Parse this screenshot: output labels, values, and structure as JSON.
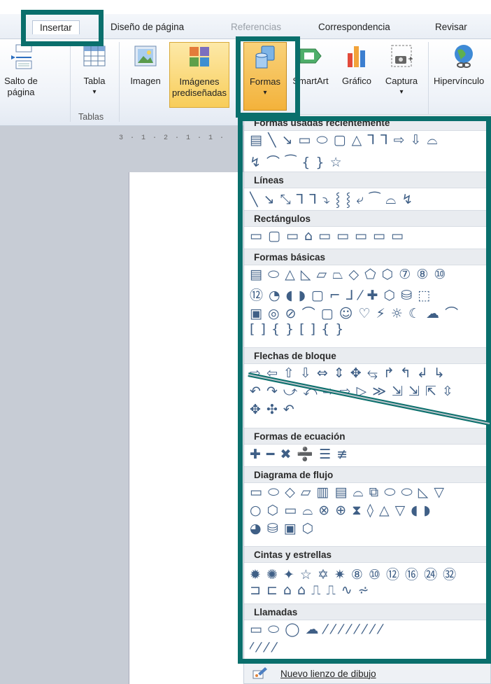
{
  "tabs": [
    {
      "label": "Insertar",
      "active": true
    },
    {
      "label": "Diseño de página",
      "active": false
    },
    {
      "label": "Referencias",
      "active": false,
      "dim": true
    },
    {
      "label": "Correspondencia",
      "active": false
    },
    {
      "label": "Revisar",
      "active": false
    }
  ],
  "ribbon": {
    "salto": {
      "line1": "Salto de",
      "line2": "página"
    },
    "tabla": {
      "label": "Tabla",
      "arrow": "▾"
    },
    "tablas_group": "Tablas",
    "imagen": "Imagen",
    "imagenes": {
      "line1": "Imágenes",
      "line2": "prediseñadas"
    },
    "formas": {
      "label": "Formas",
      "arrow": "▾"
    },
    "smartart": "SmartArt",
    "grafico": "Gráfico",
    "captura": {
      "label": "Captura",
      "arrow": "▾"
    },
    "hipervinculo": "Hipervínculo"
  },
  "ruler": "3 · 1 · 2 · 1 · 1 ·",
  "gallery": {
    "recent_header": "Formas usadas recientemente",
    "recent_rows": [
      "▤ ╲ ↘ ▭ ⬭ ▢ △ ⅂ ⅂ ⇨ ⇩ ⌓",
      "↯ ⌒ ⁀ { } ☆"
    ],
    "sections": [
      {
        "header": "Líneas",
        "rows": [
          "╲ ↘ ⤡ ⅂ ⅂ ⤵ ⸾ ⸾ ⤶ ⁀ ⌓ ↯"
        ]
      },
      {
        "header": "Rectángulos",
        "rows": [
          "▭ ▢ ▭ ⌂ ▭ ▭ ▭ ▭ ▭"
        ]
      },
      {
        "header": "Formas básicas",
        "rows": [
          "▤ ⬭ △ ◺ ▱ ⏢ ◇ ⬠ ⬡ ⑦ ⑧ ⑩",
          "⑫ ◔ ◖ ◗ ▢ ⌐ ⅃ ⁄ ✚ ⬡ ⛁ ⬚",
          "▣ ◎ ⊘ ⌒ ▢ ☺ ♡ ⚡ ☼ ☾ ☁ ⌒",
          "[ ] { } [ ] { }"
        ]
      },
      {
        "header": "Flechas de bloque",
        "rows": [
          "⇨ ⇦ ⇧ ⇩ ⇔ ⇕ ✥ ⥃ ↱ ↰ ↲ ↳",
          "↶ ↷ ⤻ ⤺ ⇨ ⇨ ▷ ≫ ⇲ ⇲ ⇱ ⇳",
          "✥ ✣ ↶"
        ]
      },
      {
        "header": "Formas de ecuación",
        "rows": [
          "✚ ━ ✖ ➗ ☰ ≢"
        ]
      },
      {
        "header": "Diagrama de flujo",
        "rows": [
          "▭ ⬭ ◇ ▱ ▥ ▤ ⌓ ⧉ ⬭ ⬭ ◺ ▽",
          "○ ⬡ ▭ ⌓ ⊗ ⊕ ⧗ ◊ △ ▽ ◖ ◗",
          "◕ ⛁ ▣ ⬡"
        ]
      },
      {
        "header": "Cintas y estrellas",
        "rows": [
          "✹ ✺ ✦ ☆ ✡ ✷ ⑧ ⑩ ⑫ ⑯ ㉔ ㉜",
          "⊐ ⊏ ⌂ ⌂ ⎍ ⎍ ∿ ⩫"
        ]
      },
      {
        "header": "Llamadas",
        "rows": [
          "▭ ⬭ ◯ ☁ ⁄ ⁄ ⁄ ⁄ ⁄ ⁄ ⁄ ⁄",
          "⁄ ⁄ ⁄ ⁄"
        ]
      }
    ]
  },
  "footer": {
    "label": "Nuevo lienzo de dibujo",
    "underline_char": "N"
  },
  "colors": {
    "highlight": "#0a6f6c",
    "shape": "#3f5f86"
  }
}
